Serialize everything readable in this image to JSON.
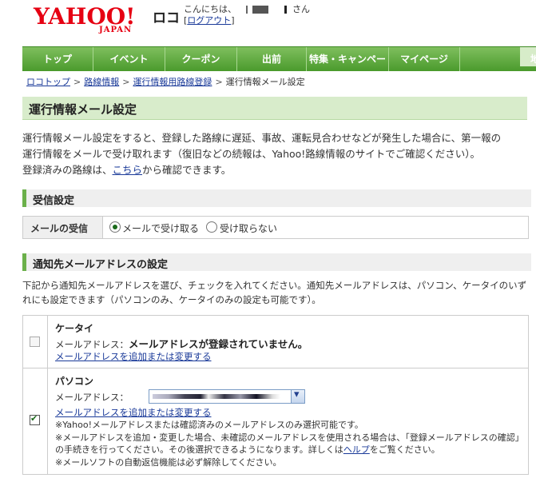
{
  "header": {
    "logo_main": "YAHOO!",
    "logo_sub": "JAPAN",
    "service_name": "ロコ",
    "greeting": "こんにちは、",
    "greeting_suffix": "さん",
    "logout_link": "ログアウト"
  },
  "nav": {
    "items": [
      "トップ",
      "イベント",
      "クーポン",
      "出前",
      "特集・キャンペーン",
      "マイページ"
    ],
    "right_label": "地"
  },
  "breadcrumb": {
    "items": [
      "ロコトップ",
      "路線情報",
      "運行情報用路線登録"
    ],
    "current": "運行情報メール設定"
  },
  "page_title": "運行情報メール設定",
  "description": {
    "line1": "運行情報メール設定をすると、登録した路線に遅延、事故、運転見合わせなどが発生した場合に、第一報の",
    "line2": "運行情報をメールで受け取れます（復旧などの続報は、Yahoo!路線情報のサイトでご確認ください）。",
    "line3_pre": "登録済みの路線は、",
    "line3_link": "こちら",
    "line3_post": "から確認できます。"
  },
  "receive_section": {
    "title": "受信設定",
    "label": "メールの受信",
    "option_receive": "メールで受け取る",
    "option_reject": "受け取らない",
    "selected": "メールで受け取る"
  },
  "address_section": {
    "title": "通知先メールアドレスの設定",
    "notice_line1": "下記から通知先メールアドレスを選び、チェックを入れてください。通知先メールアドレスは、パソコン、ケータイのいず",
    "notice_line2": "れにも設定できます（パソコンのみ、ケータイのみの設定も可能です）。"
  },
  "mobile": {
    "title": "ケータイ",
    "address_label": "メールアドレス：",
    "address_value": "メールアドレスが登録されていません。",
    "change_link": "メールアドレスを追加または変更する",
    "checked": false
  },
  "pc": {
    "title": "パソコン",
    "address_label": "メールアドレス：",
    "change_link": "メールアドレスを追加または変更する",
    "checked": true,
    "note1": "※Yahoo!メールアドレスまたは確認済みのメールアドレスのみ選択可能です。",
    "note2": "※メールアドレスを追加・変更した場合、未確認のメールアドレスを使用される場合は、「登録メールアドレスの確認」",
    "note3_pre": "の手続きを行ってください。その後選択できるようになります。詳しくは",
    "note3_link": "ヘルプ",
    "note3_post": "をご覧ください。",
    "note4": "※メールソフトの自動返信機能は必ず解除してください。"
  },
  "colors": {
    "brand_red": "#e60012",
    "nav_green": "#4a9a2c",
    "title_bg": "#d8eccb",
    "link": "#1a3a99"
  }
}
